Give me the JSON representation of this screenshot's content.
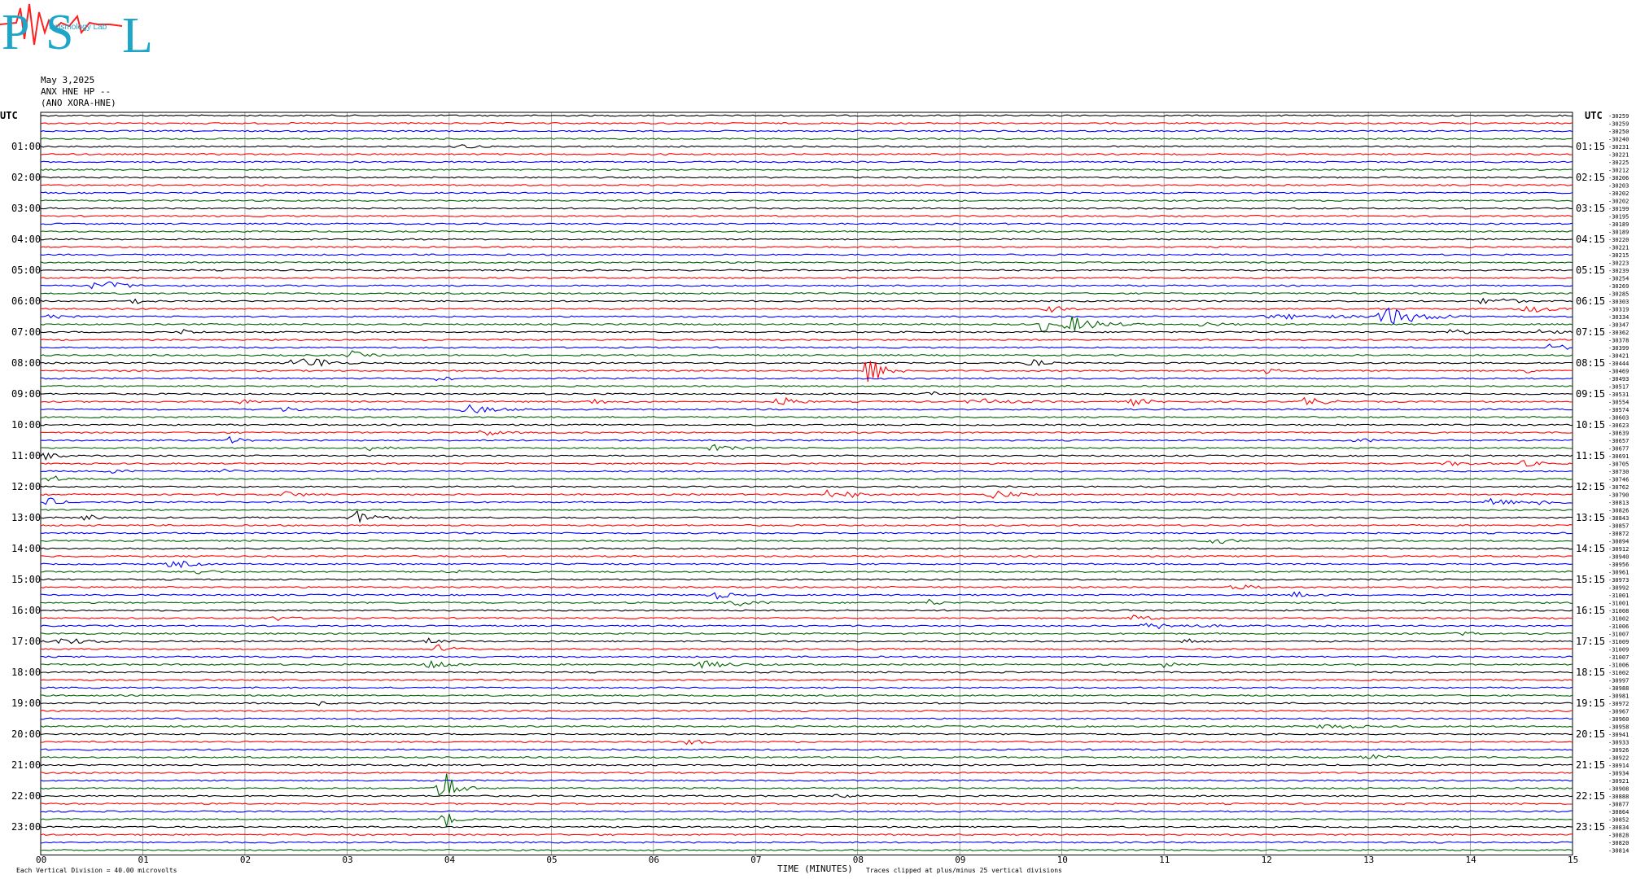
{
  "header": {
    "logo_letters": [
      "P",
      "S",
      "L"
    ],
    "logo_subtitle": "Seismology Lab",
    "date": "May 3,2025",
    "station": "ANX HNE HP --",
    "channel": "(ANO XORA-HNE)"
  },
  "axes": {
    "left_title": "UTC",
    "right_title": "UTC",
    "x_title": "TIME (MINUTES)",
    "x_ticks": [
      "00",
      "01",
      "02",
      "03",
      "04",
      "05",
      "06",
      "07",
      "08",
      "09",
      "10",
      "11",
      "12",
      "13",
      "14",
      "15"
    ],
    "left_hours": [
      "01:00",
      "02:00",
      "03:00",
      "04:00",
      "05:00",
      "06:00",
      "07:00",
      "08:00",
      "09:00",
      "10:00",
      "11:00",
      "12:00",
      "13:00",
      "14:00",
      "15:00",
      "16:00",
      "17:00",
      "18:00",
      "19:00",
      "20:00",
      "21:00",
      "22:00",
      "23:00"
    ],
    "right_hours": [
      "01:15",
      "02:15",
      "03:15",
      "04:15",
      "05:15",
      "06:15",
      "07:15",
      "08:15",
      "09:15",
      "10:15",
      "11:15",
      "12:15",
      "13:15",
      "14:15",
      "15:15",
      "16:15",
      "17:15",
      "18:15",
      "19:15",
      "20:15",
      "21:15",
      "22:15",
      "23:15"
    ]
  },
  "footer": {
    "scale": "Each Vertical Division =   40.00 microvolts",
    "clip": "Traces clipped at plus/minus 25 vertical divisions"
  },
  "chart_data": {
    "type": "line",
    "title": "",
    "xlabel": "TIME (MINUTES)",
    "ylabel": "UTC",
    "xlim": [
      0,
      15
    ],
    "trace_colors": [
      "#000000",
      "#ff0000",
      "#0000ff",
      "#006400"
    ],
    "traces_per_hour": 4,
    "trace_count": 96,
    "row_offsets": [
      "-30259",
      "-30259",
      "-30250",
      "-30240",
      "-30231",
      "-30221",
      "-30225",
      "-30212",
      "-30206",
      "-30203",
      "-30202",
      "-30202",
      "-30199",
      "-30195",
      "-30189",
      "-30189",
      "-30220",
      "-30221",
      "-30215",
      "-30223",
      "-30239",
      "-30254",
      "-30269",
      "-30285",
      "-30303",
      "-30319",
      "-30334",
      "-30347",
      "-30362",
      "-30378",
      "-30399",
      "-30421",
      "-30444",
      "-30469",
      "-30493",
      "-30517",
      "-30531",
      "-30554",
      "-30574",
      "-30603",
      "-30623",
      "-30639",
      "-30657",
      "-30677",
      "-30691",
      "-30705",
      "-30730",
      "-30746",
      "-30762",
      "-30790",
      "-30813",
      "-30826",
      "-30843",
      "-30857",
      "-30872",
      "-30894",
      "-30912",
      "-30940",
      "-30956",
      "-30961",
      "-30973",
      "-30992",
      "-31001",
      "-31001",
      "-31008",
      "-31002",
      "-31006",
      "-31007",
      "-31009",
      "-31009",
      "-31007",
      "-31006",
      "-31002",
      "-30997",
      "-30988",
      "-30981",
      "-30972",
      "-30967",
      "-30960",
      "-30958",
      "-30941",
      "-30933",
      "-30926",
      "-30922",
      "-30914",
      "-30934",
      "-30921",
      "-30908",
      "-30888",
      "-30877",
      "-30864",
      "-30852",
      "-30834",
      "-30828",
      "-30820",
      "-30814"
    ],
    "events": [
      {
        "row": 4,
        "minute": 4.1,
        "amp": 4,
        "width": 0.25
      },
      {
        "row": 22,
        "minute": 0.5,
        "amp": 4,
        "width": 0.35
      },
      {
        "row": 22,
        "minute": 0.7,
        "amp": 5,
        "width": 0.3
      },
      {
        "row": 24,
        "minute": 0.9,
        "amp": 5,
        "width": 0.2
      },
      {
        "row": 24,
        "minute": 14.3,
        "amp": 8,
        "width": 0.2
      },
      {
        "row": 24,
        "minute": 14.1,
        "amp": 6,
        "width": 0.15
      },
      {
        "row": 25,
        "minute": 9.9,
        "amp": 4,
        "width": 0.3
      },
      {
        "row": 25,
        "minute": 14.6,
        "amp": 5,
        "width": 0.5
      },
      {
        "row": 26,
        "minute": 0.1,
        "amp": 5,
        "width": 0.2
      },
      {
        "row": 26,
        "minute": 13.2,
        "amp": 14,
        "width": 0.6
      },
      {
        "row": 26,
        "minute": 12.2,
        "amp": 3,
        "width": 1.2
      },
      {
        "row": 27,
        "minute": 9.8,
        "amp": 24,
        "width": 0.1
      },
      {
        "row": 27,
        "minute": 10.1,
        "amp": 12,
        "width": 0.5
      },
      {
        "row": 27,
        "minute": 11.4,
        "amp": 4,
        "width": 0.3
      },
      {
        "row": 28,
        "minute": 1.4,
        "amp": 4,
        "width": 0.2
      },
      {
        "row": 28,
        "minute": 13.8,
        "amp": 6,
        "width": 0.3
      },
      {
        "row": 28,
        "minute": 14.7,
        "amp": 7,
        "width": 0.2
      },
      {
        "row": 30,
        "minute": 14.8,
        "amp": 9,
        "width": 0.2
      },
      {
        "row": 31,
        "minute": 3.05,
        "amp": 6,
        "width": 0.25
      },
      {
        "row": 32,
        "minute": 2.5,
        "amp": 10,
        "width": 0.3
      },
      {
        "row": 32,
        "minute": 2.7,
        "amp": 6,
        "width": 0.3
      },
      {
        "row": 32,
        "minute": 9.7,
        "amp": 7,
        "width": 0.2
      },
      {
        "row": 33,
        "minute": 8.1,
        "amp": 24,
        "width": 0.3
      },
      {
        "row": 33,
        "minute": 12.0,
        "amp": 4,
        "width": 0.2
      },
      {
        "row": 33,
        "minute": 14.5,
        "amp": 5,
        "width": 0.25
      },
      {
        "row": 34,
        "minute": 3.9,
        "amp": 4,
        "width": 0.2
      },
      {
        "row": 36,
        "minute": 8.7,
        "amp": 4,
        "width": 0.2
      },
      {
        "row": 37,
        "minute": 1.9,
        "amp": 5,
        "width": 0.25
      },
      {
        "row": 37,
        "minute": 5.4,
        "amp": 5,
        "width": 0.25
      },
      {
        "row": 37,
        "minute": 7.25,
        "amp": 10,
        "width": 0.25
      },
      {
        "row": 37,
        "minute": 9.2,
        "amp": 4,
        "width": 0.6
      },
      {
        "row": 37,
        "minute": 10.7,
        "amp": 5,
        "width": 0.3
      },
      {
        "row": 37,
        "minute": 12.4,
        "amp": 8,
        "width": 0.3
      },
      {
        "row": 38,
        "minute": 4.2,
        "amp": 6,
        "width": 0.5
      },
      {
        "row": 38,
        "minute": 2.4,
        "amp": 3,
        "width": 0.6
      },
      {
        "row": 41,
        "minute": 4.35,
        "amp": 6,
        "width": 0.25
      },
      {
        "row": 42,
        "minute": 1.85,
        "amp": 6,
        "width": 0.2
      },
      {
        "row": 42,
        "minute": 12.9,
        "amp": 5,
        "width": 0.2
      },
      {
        "row": 43,
        "minute": 3.2,
        "amp": 4,
        "width": 0.3
      },
      {
        "row": 43,
        "minute": 6.6,
        "amp": 4,
        "width": 0.4
      },
      {
        "row": 44,
        "minute": 0.05,
        "amp": 5,
        "width": 0.2
      },
      {
        "row": 45,
        "minute": 14.5,
        "amp": 5,
        "width": 0.3
      },
      {
        "row": 45,
        "minute": 13.8,
        "amp": 3,
        "width": 0.4
      },
      {
        "row": 46,
        "minute": 0.7,
        "amp": 4,
        "width": 0.2
      },
      {
        "row": 46,
        "minute": 1.8,
        "amp": 4,
        "width": 0.25
      },
      {
        "row": 47,
        "minute": 0.1,
        "amp": 5,
        "width": 0.3
      },
      {
        "row": 49,
        "minute": 2.4,
        "amp": 5,
        "width": 0.3
      },
      {
        "row": 49,
        "minute": 7.7,
        "amp": 9,
        "width": 0.1
      },
      {
        "row": 49,
        "minute": 7.9,
        "amp": 6,
        "width": 0.2
      },
      {
        "row": 49,
        "minute": 9.35,
        "amp": 7,
        "width": 0.35
      },
      {
        "row": 50,
        "minute": 0.05,
        "amp": 9,
        "width": 0.2
      },
      {
        "row": 50,
        "minute": 14.2,
        "amp": 8,
        "width": 0.3
      },
      {
        "row": 50,
        "minute": 14.7,
        "amp": 4,
        "width": 0.6
      },
      {
        "row": 52,
        "minute": 0.45,
        "amp": 5,
        "width": 0.2
      },
      {
        "row": 52,
        "minute": 3.1,
        "amp": 10,
        "width": 0.4
      },
      {
        "row": 55,
        "minute": 11.5,
        "amp": 5,
        "width": 0.3
      },
      {
        "row": 58,
        "minute": 1.3,
        "amp": 7,
        "width": 0.3
      },
      {
        "row": 59,
        "minute": 1.5,
        "amp": 5,
        "width": 0.3
      },
      {
        "row": 59,
        "minute": 4.0,
        "amp": 4,
        "width": 0.3
      },
      {
        "row": 61,
        "minute": 11.7,
        "amp": 5,
        "width": 0.3
      },
      {
        "row": 62,
        "minute": 6.6,
        "amp": 6,
        "width": 0.3
      },
      {
        "row": 62,
        "minute": 12.3,
        "amp": 5,
        "width": 0.25
      },
      {
        "row": 63,
        "minute": 6.8,
        "amp": 5,
        "width": 0.4
      },
      {
        "row": 63,
        "minute": 8.7,
        "amp": 5,
        "width": 0.2
      },
      {
        "row": 65,
        "minute": 2.3,
        "amp": 4,
        "width": 0.25
      },
      {
        "row": 65,
        "minute": 10.7,
        "amp": 4,
        "width": 0.3
      },
      {
        "row": 66,
        "minute": 10.9,
        "amp": 4,
        "width": 0.8
      },
      {
        "row": 67,
        "minute": 13.9,
        "amp": 4,
        "width": 0.2
      },
      {
        "row": 68,
        "minute": 0.2,
        "amp": 5,
        "width": 0.5
      },
      {
        "row": 68,
        "minute": 3.8,
        "amp": 4,
        "width": 0.2
      },
      {
        "row": 68,
        "minute": 11.2,
        "amp": 6,
        "width": 0.2
      },
      {
        "row": 69,
        "minute": 3.9,
        "amp": 6,
        "width": 0.3
      },
      {
        "row": 71,
        "minute": 3.8,
        "amp": 8,
        "width": 0.35
      },
      {
        "row": 71,
        "minute": 6.5,
        "amp": 5,
        "width": 0.5
      },
      {
        "row": 71,
        "minute": 11.0,
        "amp": 4,
        "width": 0.3
      },
      {
        "row": 76,
        "minute": 2.7,
        "amp": 5,
        "width": 0.1
      },
      {
        "row": 79,
        "minute": 12.6,
        "amp": 4,
        "width": 0.5
      },
      {
        "row": 81,
        "minute": 6.3,
        "amp": 5,
        "width": 0.3
      },
      {
        "row": 83,
        "minute": 13.0,
        "amp": 6,
        "width": 0.3
      },
      {
        "row": 87,
        "minute": 3.93,
        "amp": 40,
        "width": 0.22
      },
      {
        "row": 88,
        "minute": 7.8,
        "amp": 4,
        "width": 0.2
      },
      {
        "row": 91,
        "minute": 3.95,
        "amp": 18,
        "width": 0.15
      }
    ]
  },
  "colors": {
    "grid": "#808080",
    "text": "#000000",
    "logo_blue": "#1ea6c8",
    "logo_red": "#ff2020"
  }
}
